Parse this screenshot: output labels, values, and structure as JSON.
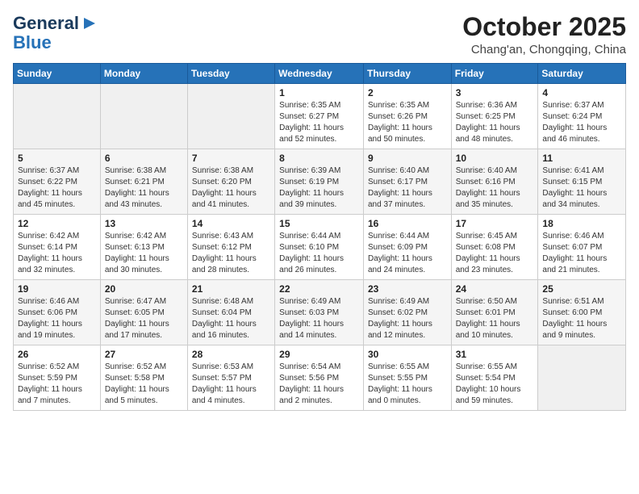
{
  "header": {
    "logo_line1": "General",
    "logo_line2": "Blue",
    "month": "October 2025",
    "location": "Chang'an, Chongqing, China"
  },
  "weekdays": [
    "Sunday",
    "Monday",
    "Tuesday",
    "Wednesday",
    "Thursday",
    "Friday",
    "Saturday"
  ],
  "weeks": [
    [
      {
        "day": "",
        "info": ""
      },
      {
        "day": "",
        "info": ""
      },
      {
        "day": "",
        "info": ""
      },
      {
        "day": "1",
        "info": "Sunrise: 6:35 AM\nSunset: 6:27 PM\nDaylight: 11 hours\nand 52 minutes."
      },
      {
        "day": "2",
        "info": "Sunrise: 6:35 AM\nSunset: 6:26 PM\nDaylight: 11 hours\nand 50 minutes."
      },
      {
        "day": "3",
        "info": "Sunrise: 6:36 AM\nSunset: 6:25 PM\nDaylight: 11 hours\nand 48 minutes."
      },
      {
        "day": "4",
        "info": "Sunrise: 6:37 AM\nSunset: 6:24 PM\nDaylight: 11 hours\nand 46 minutes."
      }
    ],
    [
      {
        "day": "5",
        "info": "Sunrise: 6:37 AM\nSunset: 6:22 PM\nDaylight: 11 hours\nand 45 minutes."
      },
      {
        "day": "6",
        "info": "Sunrise: 6:38 AM\nSunset: 6:21 PM\nDaylight: 11 hours\nand 43 minutes."
      },
      {
        "day": "7",
        "info": "Sunrise: 6:38 AM\nSunset: 6:20 PM\nDaylight: 11 hours\nand 41 minutes."
      },
      {
        "day": "8",
        "info": "Sunrise: 6:39 AM\nSunset: 6:19 PM\nDaylight: 11 hours\nand 39 minutes."
      },
      {
        "day": "9",
        "info": "Sunrise: 6:40 AM\nSunset: 6:17 PM\nDaylight: 11 hours\nand 37 minutes."
      },
      {
        "day": "10",
        "info": "Sunrise: 6:40 AM\nSunset: 6:16 PM\nDaylight: 11 hours\nand 35 minutes."
      },
      {
        "day": "11",
        "info": "Sunrise: 6:41 AM\nSunset: 6:15 PM\nDaylight: 11 hours\nand 34 minutes."
      }
    ],
    [
      {
        "day": "12",
        "info": "Sunrise: 6:42 AM\nSunset: 6:14 PM\nDaylight: 11 hours\nand 32 minutes."
      },
      {
        "day": "13",
        "info": "Sunrise: 6:42 AM\nSunset: 6:13 PM\nDaylight: 11 hours\nand 30 minutes."
      },
      {
        "day": "14",
        "info": "Sunrise: 6:43 AM\nSunset: 6:12 PM\nDaylight: 11 hours\nand 28 minutes."
      },
      {
        "day": "15",
        "info": "Sunrise: 6:44 AM\nSunset: 6:10 PM\nDaylight: 11 hours\nand 26 minutes."
      },
      {
        "day": "16",
        "info": "Sunrise: 6:44 AM\nSunset: 6:09 PM\nDaylight: 11 hours\nand 24 minutes."
      },
      {
        "day": "17",
        "info": "Sunrise: 6:45 AM\nSunset: 6:08 PM\nDaylight: 11 hours\nand 23 minutes."
      },
      {
        "day": "18",
        "info": "Sunrise: 6:46 AM\nSunset: 6:07 PM\nDaylight: 11 hours\nand 21 minutes."
      }
    ],
    [
      {
        "day": "19",
        "info": "Sunrise: 6:46 AM\nSunset: 6:06 PM\nDaylight: 11 hours\nand 19 minutes."
      },
      {
        "day": "20",
        "info": "Sunrise: 6:47 AM\nSunset: 6:05 PM\nDaylight: 11 hours\nand 17 minutes."
      },
      {
        "day": "21",
        "info": "Sunrise: 6:48 AM\nSunset: 6:04 PM\nDaylight: 11 hours\nand 16 minutes."
      },
      {
        "day": "22",
        "info": "Sunrise: 6:49 AM\nSunset: 6:03 PM\nDaylight: 11 hours\nand 14 minutes."
      },
      {
        "day": "23",
        "info": "Sunrise: 6:49 AM\nSunset: 6:02 PM\nDaylight: 11 hours\nand 12 minutes."
      },
      {
        "day": "24",
        "info": "Sunrise: 6:50 AM\nSunset: 6:01 PM\nDaylight: 11 hours\nand 10 minutes."
      },
      {
        "day": "25",
        "info": "Sunrise: 6:51 AM\nSunset: 6:00 PM\nDaylight: 11 hours\nand 9 minutes."
      }
    ],
    [
      {
        "day": "26",
        "info": "Sunrise: 6:52 AM\nSunset: 5:59 PM\nDaylight: 11 hours\nand 7 minutes."
      },
      {
        "day": "27",
        "info": "Sunrise: 6:52 AM\nSunset: 5:58 PM\nDaylight: 11 hours\nand 5 minutes."
      },
      {
        "day": "28",
        "info": "Sunrise: 6:53 AM\nSunset: 5:57 PM\nDaylight: 11 hours\nand 4 minutes."
      },
      {
        "day": "29",
        "info": "Sunrise: 6:54 AM\nSunset: 5:56 PM\nDaylight: 11 hours\nand 2 minutes."
      },
      {
        "day": "30",
        "info": "Sunrise: 6:55 AM\nSunset: 5:55 PM\nDaylight: 11 hours\nand 0 minutes."
      },
      {
        "day": "31",
        "info": "Sunrise: 6:55 AM\nSunset: 5:54 PM\nDaylight: 10 hours\nand 59 minutes."
      },
      {
        "day": "",
        "info": ""
      }
    ]
  ]
}
